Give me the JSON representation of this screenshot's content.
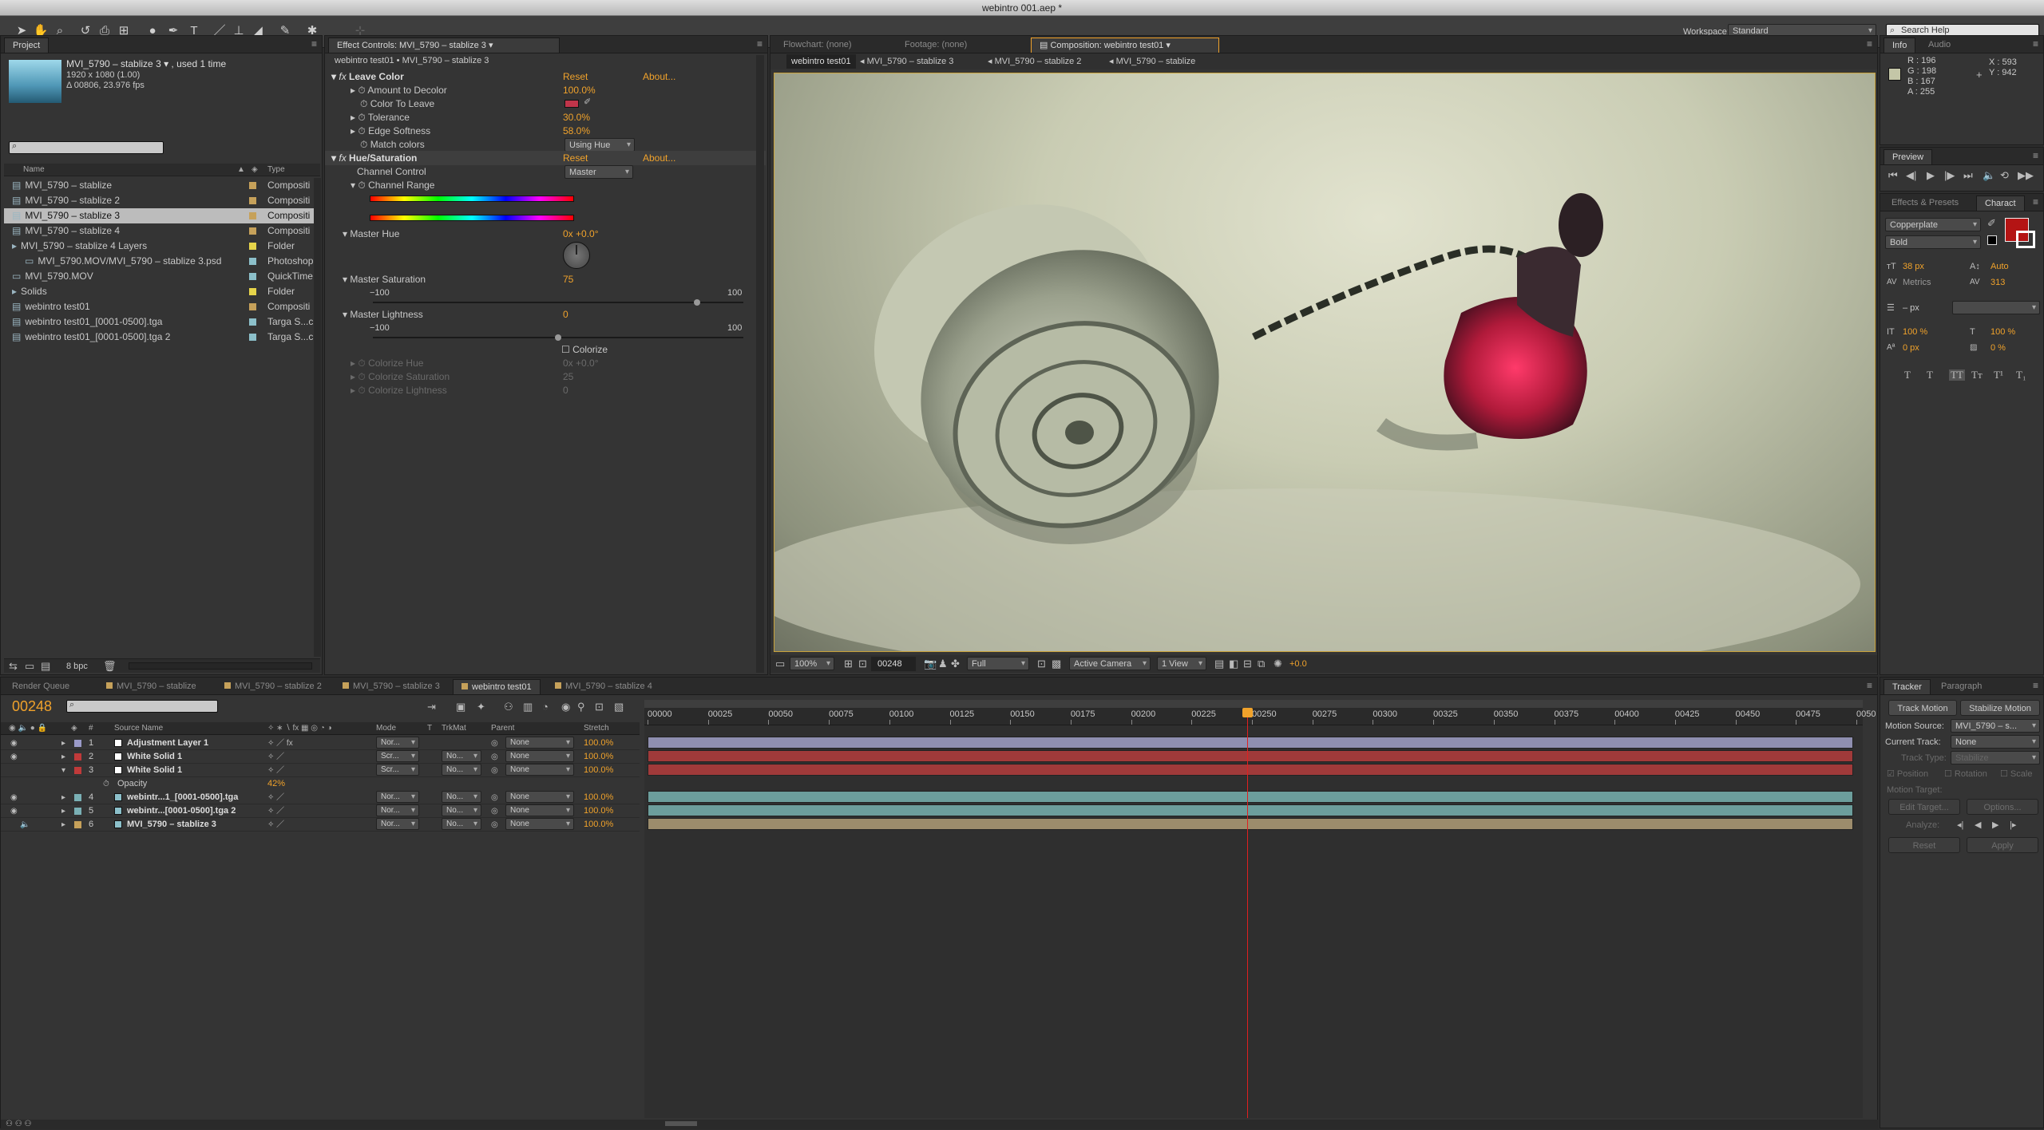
{
  "window": {
    "title": "webintro 001.aep *"
  },
  "toolbar": {
    "workspace_label": "Workspace:",
    "workspace_value": "Standard",
    "search_placeholder": "Search Help"
  },
  "project": {
    "tab": "Project",
    "selected_name": "MVI_5790 – stablize 3 ▾ , used 1 time",
    "dims": "1920 x 1080 (1.00)",
    "duration": "Δ 00806, 23.976 fps",
    "col_name": "Name",
    "col_type": "Type",
    "items": [
      {
        "name": "MVI_5790 – stablize",
        "type": "Compositi",
        "color": "#c6a15a",
        "icon": "▤",
        "indent": 0
      },
      {
        "name": "MVI_5790 – stablize 2",
        "type": "Compositi",
        "color": "#c6a15a",
        "icon": "▤",
        "indent": 0
      },
      {
        "name": "MVI_5790 – stablize 3",
        "type": "Compositi",
        "color": "#c6a15a",
        "icon": "▤",
        "indent": 0
      },
      {
        "name": "MVI_5790 – stablize 4",
        "type": "Compositi",
        "color": "#c6a15a",
        "icon": "▤",
        "indent": 0
      },
      {
        "name": "MVI_5790 – stablize 4 Layers",
        "type": "Folder",
        "color": "#e6d44a",
        "icon": "▸",
        "indent": 0
      },
      {
        "name": "MVI_5790.MOV/MVI_5790 – stablize 3.psd",
        "type": "Photoshop",
        "color": "#8cc0ca",
        "icon": "▭",
        "indent": 1
      },
      {
        "name": "MVI_5790.MOV",
        "type": "QuickTime",
        "color": "#8cc0ca",
        "icon": "▭",
        "indent": 0
      },
      {
        "name": "Solids",
        "type": "Folder",
        "color": "#e6d44a",
        "icon": "▸",
        "indent": 0
      },
      {
        "name": "webintro test01",
        "type": "Compositi",
        "color": "#c6a15a",
        "icon": "▤",
        "indent": 0
      },
      {
        "name": "webintro test01_[0001-0500].tga",
        "type": "Targa S...c",
        "color": "#8cc0ca",
        "icon": "▤",
        "indent": 0
      },
      {
        "name": "webintro test01_[0001-0500].tga 2",
        "type": "Targa S...c",
        "color": "#8cc0ca",
        "icon": "▤",
        "indent": 0
      }
    ],
    "bpc": "8 bpc"
  },
  "effects": {
    "tab": "Effect Controls: MVI_5790 – stablize 3",
    "subtitle": "webintro test01 • MVI_5790 – stablize 3",
    "reset": "Reset",
    "about": "About...",
    "leave_color": {
      "name": "Leave Color",
      "amount_label": "Amount to Decolor",
      "amount": "100.0%",
      "color_label": "Color To Leave",
      "tolerance_label": "Tolerance",
      "tolerance": "30.0%",
      "softness_label": "Edge Softness",
      "softness": "58.0%",
      "match_label": "Match colors",
      "match": "Using Hue",
      "swatch": "#c0354a"
    },
    "hue_sat": {
      "name": "Hue/Saturation",
      "channel_label": "Channel Control",
      "channel": "Master",
      "range_label": "Channel Range",
      "hue_label": "Master Hue",
      "hue": "0x +0.0°",
      "sat_label": "Master Saturation",
      "sat": "75",
      "sat_min": "−100",
      "sat_max": "100",
      "light_label": "Master Lightness",
      "light": "0",
      "light_min": "−100",
      "light_max": "100",
      "colorize": "Colorize",
      "chue_label": "Colorize Hue",
      "chue": "0x +0.0°",
      "csat_label": "Colorize Saturation",
      "csat": "25",
      "clight_label": "Colorize Lightness",
      "clight": "0"
    }
  },
  "viewer": {
    "tabs": [
      "Flowchart: (none)",
      "Footage: (none)",
      "Composition: webintro test01"
    ],
    "breadcrumbs": [
      "webintro test01",
      "MVI_5790 – stablize 3",
      "MVI_5790 – stablize 2",
      "MVI_5790 – stablize"
    ],
    "zoom": "100%",
    "timecode": "00248",
    "resolution": "Full",
    "camera": "Active Camera",
    "views": "1 View",
    "exposure": "+0.0"
  },
  "info": {
    "tabs": [
      "Info",
      "Audio"
    ],
    "r": "R : 196",
    "g": "G : 198",
    "b": "B : 167",
    "a": "A : 255",
    "x": "X : 593",
    "y": "Y : 942",
    "swatch": "#c4c6a7"
  },
  "preview": {
    "tab": "Preview"
  },
  "character": {
    "tabs": [
      "Effects & Presets",
      "Charact"
    ],
    "font": "Copperplate",
    "style": "Bold",
    "size": "38 px",
    "leading": "Auto",
    "kerning": "Metrics",
    "tracking": "313",
    "stroke": "– px",
    "vscale": "100 %",
    "hscale": "100 %",
    "baseline": "0 px",
    "tsume": "0 %",
    "styles": [
      "T",
      "T",
      "TT",
      "Tт",
      "T¹",
      "T₁"
    ],
    "fill": "#b41414"
  },
  "timeline": {
    "tabs": [
      "Render Queue",
      "MVI_5790 – stablize",
      "MVI_5790 – stablize 2",
      "MVI_5790 – stablize 3",
      "webintro test01",
      "MVI_5790 – stablize 4"
    ],
    "timecode": "00248",
    "cols": {
      "num": "#",
      "source": "Source Name",
      "mode": "Mode",
      "t": "T",
      "trkmat": "TrkMat",
      "parent": "Parent",
      "stretch": "Stretch"
    },
    "ruler": [
      "00000",
      "00025",
      "00050",
      "00075",
      "00100",
      "00125",
      "00150",
      "00175",
      "00200",
      "00225",
      "00250",
      "00275",
      "00300",
      "00325",
      "00350",
      "00375",
      "00400",
      "00425",
      "00450",
      "00475",
      "0050"
    ],
    "playhead": 248,
    "total_frames": 500,
    "layers": [
      {
        "num": "1",
        "name": "Adjustment Layer 1",
        "label": "#9a9ac8",
        "mode": "Nor...",
        "trkmat": "",
        "parent": "None",
        "stretch": "100.0%",
        "bar": "#8f8fb0",
        "icon": "□"
      },
      {
        "num": "2",
        "name": "White Solid 1",
        "label": "#c03a3a",
        "mode": "Scr...",
        "trkmat": "No...",
        "parent": "None",
        "stretch": "100.0%",
        "bar": "#a03a3a",
        "icon": "□"
      },
      {
        "num": "3",
        "name": "White Solid 1",
        "label": "#c03a3a",
        "mode": "Scr...",
        "trkmat": "No...",
        "parent": "None",
        "stretch": "100.0%",
        "bar": "#a03a3a",
        "icon": "□"
      },
      {
        "num": "4",
        "name": "webintr...1_[0001-0500].tga",
        "label": "#7ab0b5",
        "mode": "Nor...",
        "trkmat": "No...",
        "parent": "None",
        "stretch": "100.0%",
        "bar": "#6c9e9c",
        "icon": "▤"
      },
      {
        "num": "5",
        "name": "webintr...[0001-0500].tga 2",
        "label": "#7ab0b5",
        "mode": "Nor...",
        "trkmat": "No...",
        "parent": "None",
        "stretch": "100.0%",
        "bar": "#6c9e9c",
        "icon": "▤"
      },
      {
        "num": "6",
        "name": "MVI_5790 – stablize 3",
        "label": "#c6a15a",
        "mode": "Nor...",
        "trkmat": "No...",
        "parent": "None",
        "stretch": "100.0%",
        "bar": "#9c8c6c",
        "icon": "▤"
      }
    ],
    "opacity_label": "Opacity",
    "opacity": "42%"
  },
  "tracker": {
    "tabs": [
      "Tracker",
      "Paragraph"
    ],
    "track_motion": "Track Motion",
    "stabilize_motion": "Stabilize Motion",
    "source_label": "Motion Source:",
    "source": "MVI_5790 – s...",
    "current_label": "Current Track:",
    "current": "None",
    "type_label": "Track Type:",
    "type": "Stabilize",
    "position": "Position",
    "rotation": "Rotation",
    "scale": "Scale",
    "target_label": "Motion Target:",
    "edit_target": "Edit Target...",
    "options": "Options...",
    "analyze": "Analyze:",
    "reset": "Reset",
    "apply": "Apply"
  }
}
